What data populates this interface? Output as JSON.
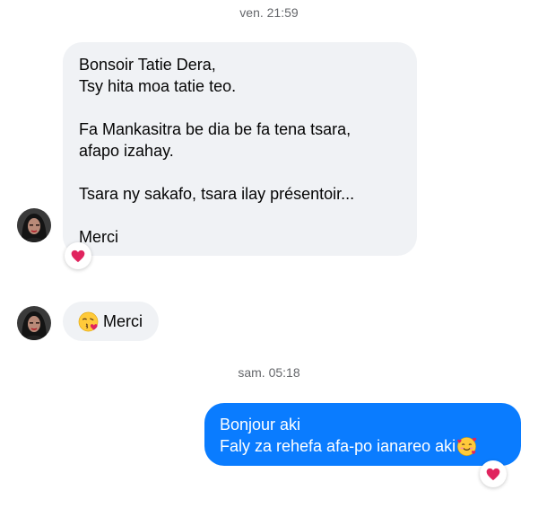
{
  "colors": {
    "incoming_bubble": "#f0f2f5",
    "outgoing_bubble": "#0a7cff",
    "timestamp_text": "#65676b",
    "reaction_heart": "#e0245e"
  },
  "conversation": {
    "timestamp_1": "ven. 21:59",
    "message_1": {
      "lines": [
        "Bonsoir Tatie Dera,",
        "Tsy hita moa tatie teo.",
        "",
        "Fa Mankasitra be dia be fa tena tsara,",
        "afapo izahay.",
        "",
        "Tsara ny sakafo, tsara ilay présentoir...",
        "",
        "Merci"
      ],
      "reaction_icon": "red-heart-icon"
    },
    "message_2": {
      "emoji_icon": "face-blowing-kiss-icon",
      "text": "Merci"
    },
    "timestamp_2": "sam. 05:18",
    "message_3": {
      "line_1": "Bonjour aki",
      "line_2": "Faly za rehefa afa-po ianareo aki",
      "emoji_icon": "smiling-face-with-hearts-icon",
      "reaction_icon": "red-heart-icon"
    }
  }
}
